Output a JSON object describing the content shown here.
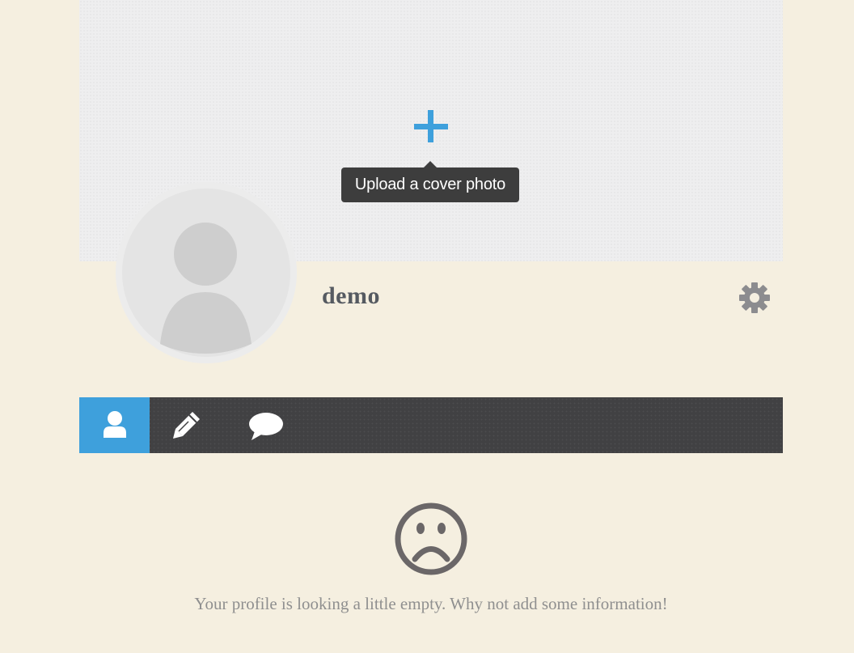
{
  "cover": {
    "upload_tooltip": "Upload a cover photo",
    "add_icon": "plus-icon",
    "accent_color": "#3ea0dc"
  },
  "profile": {
    "username": "demo",
    "avatar_icon": "default-avatar-icon",
    "settings_icon": "gear-icon"
  },
  "tabs": [
    {
      "name": "profile",
      "icon": "user-icon",
      "active": true
    },
    {
      "name": "posts",
      "icon": "pencil-icon",
      "active": false
    },
    {
      "name": "comments",
      "icon": "speech-bubble-icon",
      "active": false
    }
  ],
  "empty_state": {
    "icon": "sad-face-icon",
    "message": "Your profile is looking a little empty. Why not add some information!"
  },
  "colors": {
    "background": "#f5efe0",
    "tabbar": "#414143",
    "active_tab": "#3ea0dc",
    "tooltip": "#3d3d3d"
  }
}
